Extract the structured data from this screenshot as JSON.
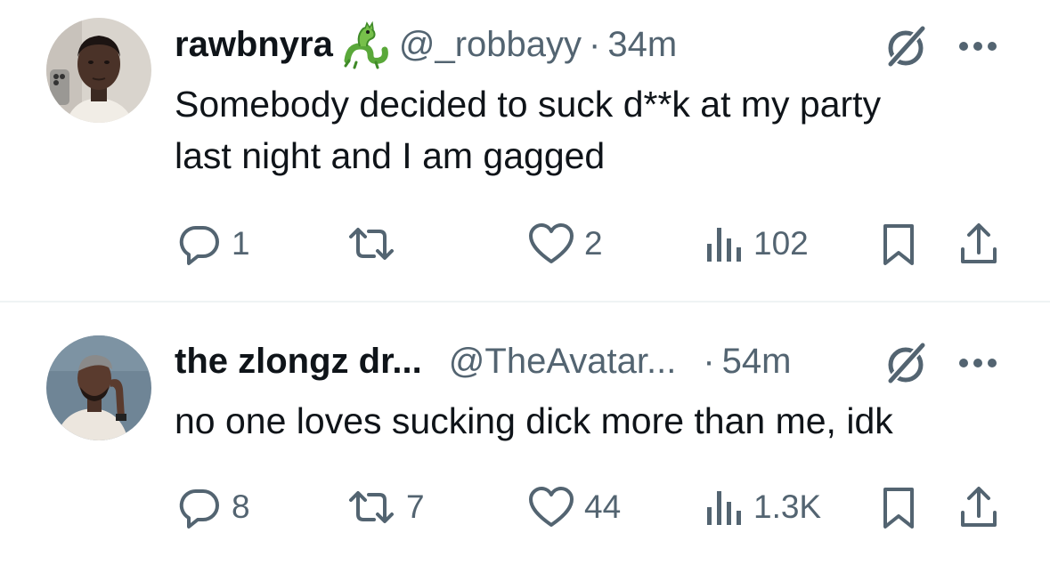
{
  "tweets": [
    {
      "name": "rawbnyra",
      "name_emoji_icon": "dragon-emoji-icon",
      "handle": "@_robbayy",
      "separator": "·",
      "time": "34m",
      "text_line1": "Somebody decided to suck d**k at my party",
      "text_line2": "last night and I am gagged",
      "replies": "1",
      "retweets": "",
      "likes": "2",
      "views": "102"
    },
    {
      "name": "the zlongz dr...",
      "handle": "@TheAvatar...",
      "separator": "·",
      "time": "54m",
      "text_line1": "no one loves sucking dick more than me, idk",
      "replies": "8",
      "retweets": "7",
      "likes": "44",
      "views": "1.3K"
    }
  ],
  "icons": [
    "grok-icon",
    "more-icon",
    "reply-icon",
    "retweet-icon",
    "like-icon",
    "views-icon",
    "bookmark-icon",
    "share-icon"
  ],
  "colors": {
    "text": "#0f1419",
    "secondary": "#536471",
    "divider": "#eff3f4"
  }
}
